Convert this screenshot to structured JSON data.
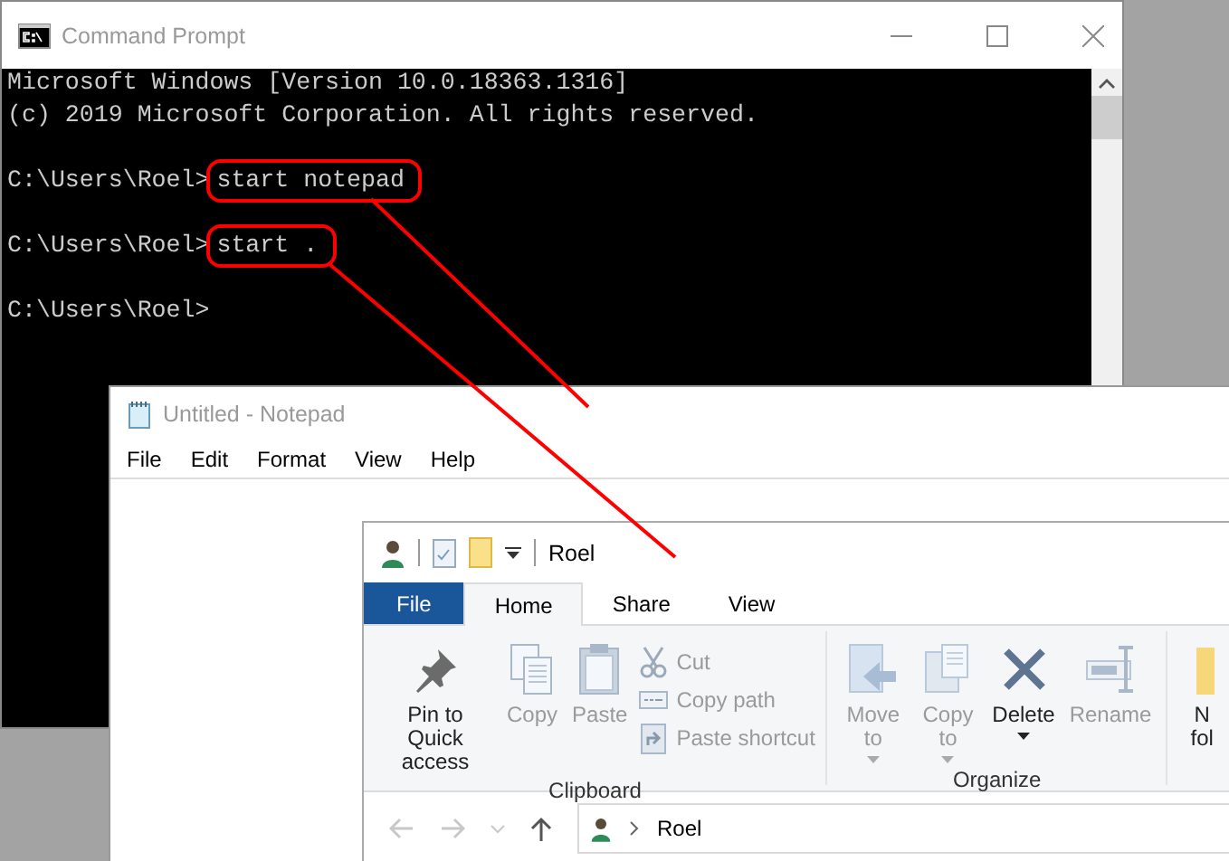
{
  "command_prompt": {
    "title": "Command Prompt",
    "lines": [
      {
        "kind": "output",
        "text": "Microsoft Windows [Version 10.0.18363.1316]"
      },
      {
        "kind": "output",
        "text": "(c) 2019 Microsoft Corporation. All rights reserved."
      },
      {
        "kind": "prompt",
        "prompt": "C:\\Users\\Roel>",
        "command": "start notepad",
        "highlighted": true
      },
      {
        "kind": "prompt",
        "prompt": "C:\\Users\\Roel>",
        "command": "start .",
        "highlighted": true
      },
      {
        "kind": "prompt",
        "prompt": "C:\\Users\\Roel>"
      }
    ]
  },
  "notepad": {
    "title": "Untitled - Notepad",
    "menu": [
      "File",
      "Edit",
      "Format",
      "View",
      "Help"
    ]
  },
  "explorer": {
    "title": "Roel",
    "tabs": [
      {
        "label": "File",
        "kind": "file",
        "selected": false
      },
      {
        "label": "Home",
        "kind": "tab",
        "selected": true
      },
      {
        "label": "Share",
        "kind": "tab",
        "selected": false
      },
      {
        "label": "View",
        "kind": "tab",
        "selected": false
      }
    ],
    "groups": [
      {
        "label": "Clipboard",
        "items": [
          {
            "kind": "large",
            "label": "Pin to Quick access",
            "disabled": false
          },
          {
            "kind": "large",
            "label": "Copy",
            "disabled": true
          },
          {
            "kind": "large",
            "label": "Paste",
            "disabled": true
          },
          {
            "kind": "small",
            "label": "Cut",
            "disabled": true
          },
          {
            "kind": "small",
            "label": "Copy path",
            "disabled": true
          },
          {
            "kind": "small",
            "label": "Paste shortcut",
            "disabled": true
          }
        ]
      },
      {
        "label": "Organize",
        "items": [
          {
            "kind": "large",
            "label": "Move to",
            "disabled": true,
            "dropdown": true
          },
          {
            "kind": "large",
            "label": "Copy to",
            "disabled": true,
            "dropdown": true
          },
          {
            "kind": "large",
            "label": "Delete",
            "disabled": false,
            "dropdown": true
          },
          {
            "kind": "large",
            "label": "Rename",
            "disabled": true,
            "dropdown": false
          }
        ]
      },
      {
        "items": [
          {
            "kind": "large",
            "label": "N fol",
            "disabled": false
          }
        ]
      }
    ],
    "address": {
      "path": "Roel"
    }
  }
}
